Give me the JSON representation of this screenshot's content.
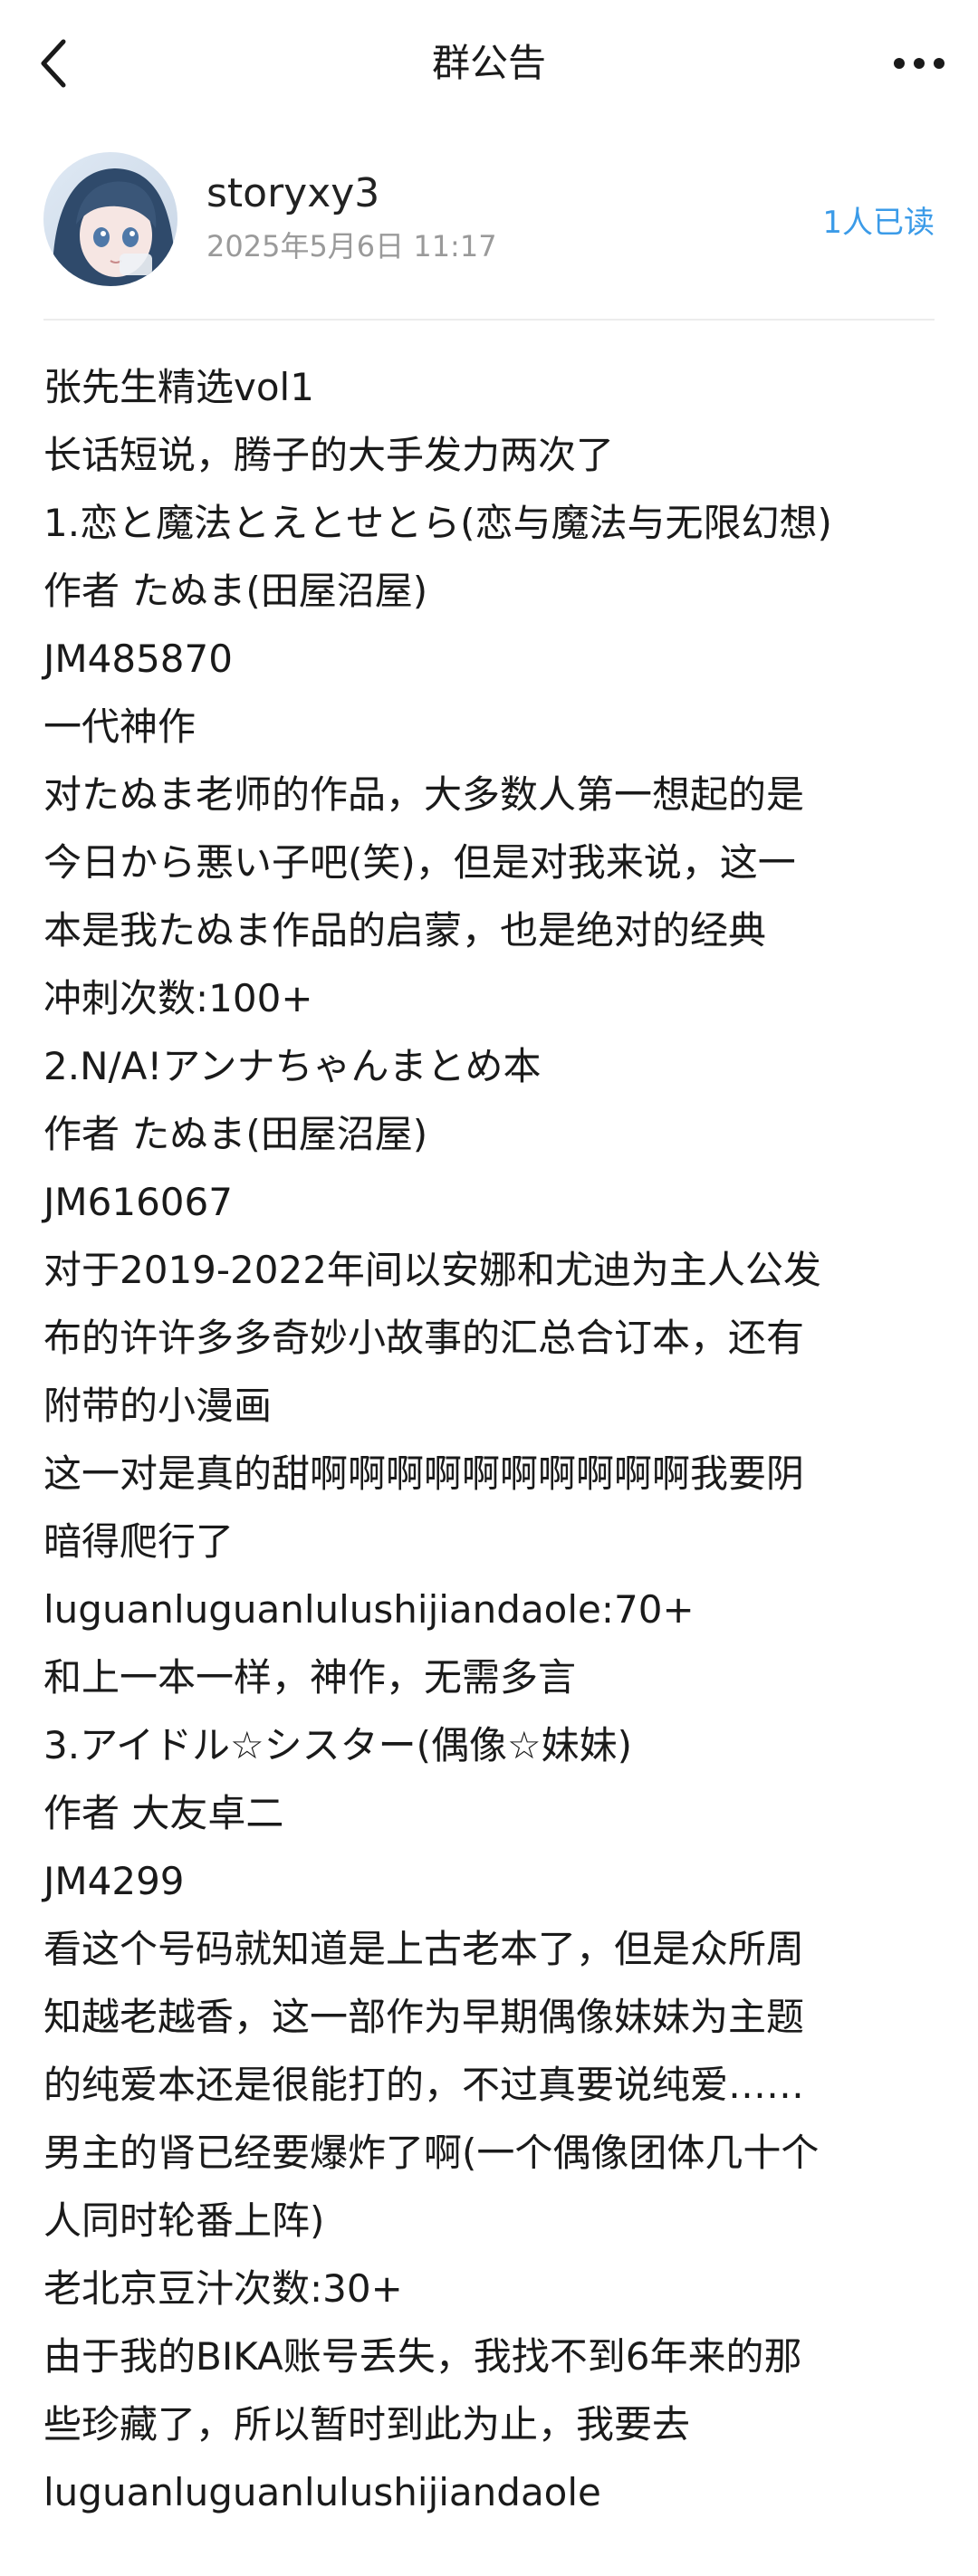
{
  "nav": {
    "title": "群公告",
    "back_icon": "chevron-left-icon",
    "more_icon": "more-horizontal-icon"
  },
  "post": {
    "username": "storyxy3",
    "timestamp": "2025年5月6日 11:17",
    "read_count": "1人已读",
    "accent_color": "#3b9be8",
    "lines": [
      "张先生精选vol1",
      "长话短说，腾子的大手发力两次了",
      "1.恋と魔法とえとせとら(恋与魔法与无限幻想)",
      "作者 たぬま(田屋沼屋)",
      "JM485870",
      "一代神作",
      "对たぬま老师的作品，大多数人第一想起的是",
      "今日から悪い子吧(笑)，但是对我来说，这一",
      "本是我たぬま作品的启蒙，也是绝对的经典",
      "冲刺次数:100+",
      "2.N/A!アンナちゃんまとめ本",
      "作者 たぬま(田屋沼屋)",
      "JM616067",
      "对于2019-2022年间以安娜和尤迪为主人公发",
      "布的许许多多奇妙小故事的汇总合订本，还有",
      "附带的小漫画",
      "这一对是真的甜啊啊啊啊啊啊啊啊啊啊我要阴",
      "暗得爬行了",
      "luguanluguanlulushijiandaole:70+",
      "和上一本一样，神作，无需多言",
      "3.アイドル☆シスター(偶像☆妹妹)",
      "作者 大友卓二",
      "JM4299",
      "看这个号码就知道是上古老本了，但是众所周",
      "知越老越香，这一部作为早期偶像妹妹为主题",
      "的纯爱本还是很能打的，不过真要说纯爱……",
      "男主的肾已经要爆炸了啊(一个偶像团体几十个",
      "人同时轮番上阵)",
      "老北京豆汁次数:30+",
      "由于我的BIKA账号丢失，我找不到6年来的那",
      "些珍藏了，所以暂时到此为止，我要去",
      "luguanluguanlulushijiandaole"
    ]
  }
}
